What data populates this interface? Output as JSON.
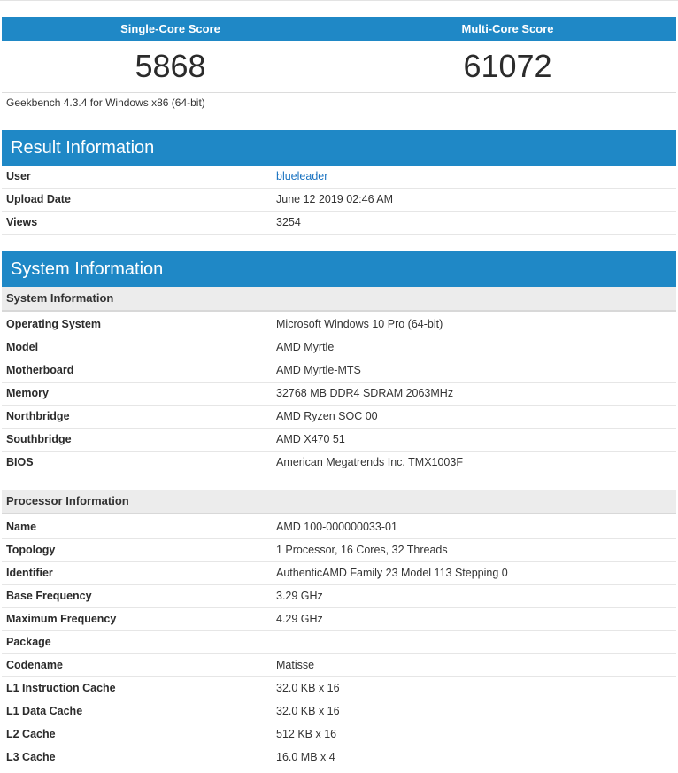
{
  "scores": {
    "single_label": "Single-Core Score",
    "single_value": "5868",
    "multi_label": "Multi-Core Score",
    "multi_value": "61072"
  },
  "version": "Geekbench 4.3.4 for Windows x86 (64-bit)",
  "result_info": {
    "title": "Result Information",
    "rows": [
      {
        "key": "User",
        "value": "blueleader"
      },
      {
        "key": "Upload Date",
        "value": "June 12 2019 02:46 AM"
      },
      {
        "key": "Views",
        "value": "3254"
      }
    ]
  },
  "system_info": {
    "title": "System Information",
    "subsection_title": "System Information",
    "rows": [
      {
        "key": "Operating System",
        "value": "Microsoft Windows 10 Pro (64-bit)"
      },
      {
        "key": "Model",
        "value": "AMD Myrtle"
      },
      {
        "key": "Motherboard",
        "value": "AMD Myrtle-MTS"
      },
      {
        "key": "Memory",
        "value": "32768 MB DDR4 SDRAM 2063MHz"
      },
      {
        "key": "Northbridge",
        "value": "AMD Ryzen SOC 00"
      },
      {
        "key": "Southbridge",
        "value": "AMD X470 51"
      },
      {
        "key": "BIOS",
        "value": "American Megatrends Inc. TMX1003F"
      }
    ]
  },
  "processor_info": {
    "subsection_title": "Processor Information",
    "rows": [
      {
        "key": "Name",
        "value": "AMD 100-000000033-01"
      },
      {
        "key": "Topology",
        "value": "1 Processor, 16 Cores, 32 Threads"
      },
      {
        "key": "Identifier",
        "value": "AuthenticAMD Family 23 Model 113 Stepping 0"
      },
      {
        "key": "Base Frequency",
        "value": "3.29 GHz"
      },
      {
        "key": "Maximum Frequency",
        "value": "4.29 GHz"
      },
      {
        "key": "Package",
        "value": ""
      },
      {
        "key": "Codename",
        "value": "Matisse"
      },
      {
        "key": "L1 Instruction Cache",
        "value": "32.0 KB x 16"
      },
      {
        "key": "L1 Data Cache",
        "value": "32.0 KB x 16"
      },
      {
        "key": "L2 Cache",
        "value": "512 KB x 16"
      },
      {
        "key": "L3 Cache",
        "value": "16.0 MB x 4"
      }
    ]
  },
  "colors": {
    "header_blue": "#1f88c6",
    "link_blue": "#1a73c1"
  }
}
